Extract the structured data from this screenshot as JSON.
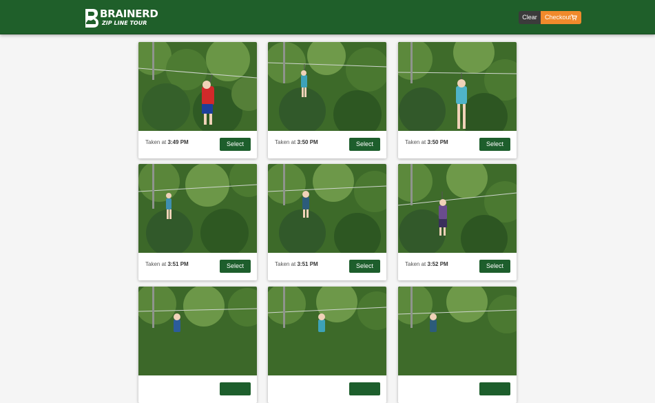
{
  "brand": {
    "name": "BRAINERD",
    "tagline": "ZIP LINE TOUR",
    "color": "#1f5f2a"
  },
  "header": {
    "clear_label": "Clear",
    "checkout_label": "Checkout",
    "cart_icon": "cart-icon",
    "checkout_color": "#f08a2c"
  },
  "photos": [
    {
      "prefix": "Taken at",
      "time": "3:49 PM",
      "select_label": "Select"
    },
    {
      "prefix": "Taken at",
      "time": "3:50 PM",
      "select_label": "Select"
    },
    {
      "prefix": "Taken at",
      "time": "3:50 PM",
      "select_label": "Select"
    },
    {
      "prefix": "Taken at",
      "time": "3:51 PM",
      "select_label": "Select"
    },
    {
      "prefix": "Taken at",
      "time": "3:51 PM",
      "select_label": "Select"
    },
    {
      "prefix": "Taken at",
      "time": "3:52 PM",
      "select_label": "Select"
    },
    {
      "prefix": "",
      "time": "",
      "select_label": ""
    },
    {
      "prefix": "",
      "time": "",
      "select_label": ""
    },
    {
      "prefix": "",
      "time": "",
      "select_label": ""
    }
  ]
}
